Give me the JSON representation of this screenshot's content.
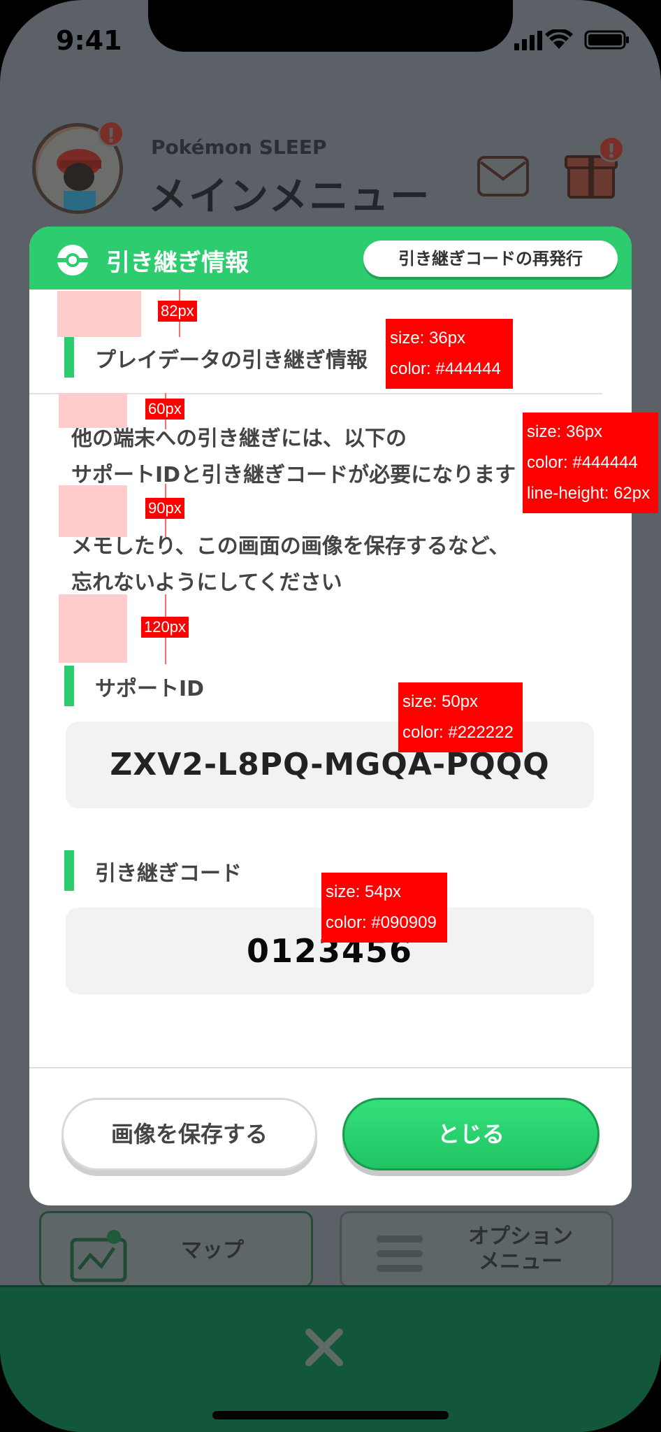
{
  "status": {
    "time": "9:41"
  },
  "background": {
    "brand": "Pokémon SLEEP",
    "title": "メインメニュー",
    "badge": "!",
    "cards": {
      "map": "マップ",
      "option_line1": "オプション",
      "option_line2": "メニュー"
    }
  },
  "modal": {
    "title": "引き継ぎ情報",
    "reissue_button": "引き継ぎコードの再発行",
    "section_heading": "プレイデータの引き継ぎ情報",
    "paragraph1_line1": "他の端末への引き継ぎには、以下の",
    "paragraph1_line2": "サポートIDと引き継ぎコードが必要になります",
    "paragraph2_line1": "メモしたり、この画面の画像を保存するなど、",
    "paragraph2_line2": "忘れないようにしてください",
    "support_id_label": "サポートID",
    "support_id_value": "ZXV2-L8PQ-MGQA-PQQQ",
    "transfer_code_label": "引き継ぎコード",
    "transfer_code_value": "0123456",
    "save_button": "画像を保存する",
    "close_button": "とじる"
  },
  "annotations": {
    "gap_82": "82px",
    "gap_60": "60px",
    "gap_90": "90px",
    "gap_120": "120px",
    "heading_size": "size: 36px",
    "heading_color": "color: #444444",
    "body_size": "size: 36px",
    "body_color": "color: #444444",
    "body_line_height": "line-height: 62px",
    "support_size": "size: 50px",
    "support_color": "color: #222222",
    "code_size": "size: 54px",
    "code_color": "color: #090909"
  },
  "colors": {
    "accent_green": "#2dcc6e",
    "text_primary": "#444444",
    "annotation_red": "#ff0000",
    "bottom_bar": "#12573a"
  }
}
